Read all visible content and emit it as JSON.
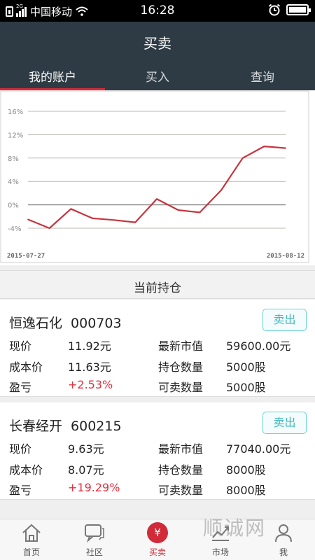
{
  "status_bar": {
    "network": "2G",
    "carrier": "中国移动",
    "time": "16:28"
  },
  "header": {
    "title": "买卖",
    "tabs": [
      {
        "label": "我的账户",
        "active": true
      },
      {
        "label": "买入",
        "active": false
      },
      {
        "label": "查询",
        "active": false
      }
    ]
  },
  "chart_data": {
    "type": "line",
    "x_start_label": "2015-07-27",
    "x_end_label": "2015-08-12",
    "y_ticks": [
      "16%",
      "12%",
      "8%",
      "4%",
      "0%",
      "-4%"
    ],
    "y_values": [
      16,
      12,
      8,
      4,
      0,
      -4
    ],
    "ylim": [
      -4,
      16
    ],
    "grid": true,
    "series_color": "#c8343f",
    "values": [
      -2.5,
      -4.0,
      -0.7,
      -2.3,
      -2.6,
      -3.0,
      1.0,
      -0.9,
      -1.3,
      2.5,
      8.0,
      10.0,
      9.7
    ]
  },
  "holdings": {
    "section_title": "当前持仓",
    "sell_label": "卖出",
    "labels": {
      "price": "现价",
      "cost": "成本价",
      "pnl": "盈亏",
      "market_value": "最新市值",
      "quantity": "持仓数量",
      "sellable": "可卖数量"
    },
    "items": [
      {
        "name": "恒逸石化",
        "code": "000703",
        "price": "11.92元",
        "cost": "11.63元",
        "pnl": "+2.53%",
        "market_value": "59600.00元",
        "quantity": "5000股",
        "sellable": "5000股"
      },
      {
        "name": "长春经开",
        "code": "600215",
        "price": "9.63元",
        "cost": "8.07元",
        "pnl": "+19.29%",
        "market_value": "77040.00元",
        "quantity": "8000股",
        "sellable": "8000股"
      }
    ]
  },
  "tabbar": {
    "items": [
      {
        "label": "首页",
        "icon": "home-icon"
      },
      {
        "label": "社区",
        "icon": "chat-icon"
      },
      {
        "label": "买卖",
        "icon": "yuan-icon",
        "glyph": "¥"
      },
      {
        "label": "市场",
        "icon": "market-icon"
      },
      {
        "label": "我",
        "icon": "user-icon"
      }
    ]
  },
  "watermark": "顺诚网",
  "colors": {
    "header_bg": "#2e3b44",
    "accent_red": "#d12b3a",
    "profit_red": "#e0303e",
    "sell_button_teal": "#3fb8bd"
  }
}
